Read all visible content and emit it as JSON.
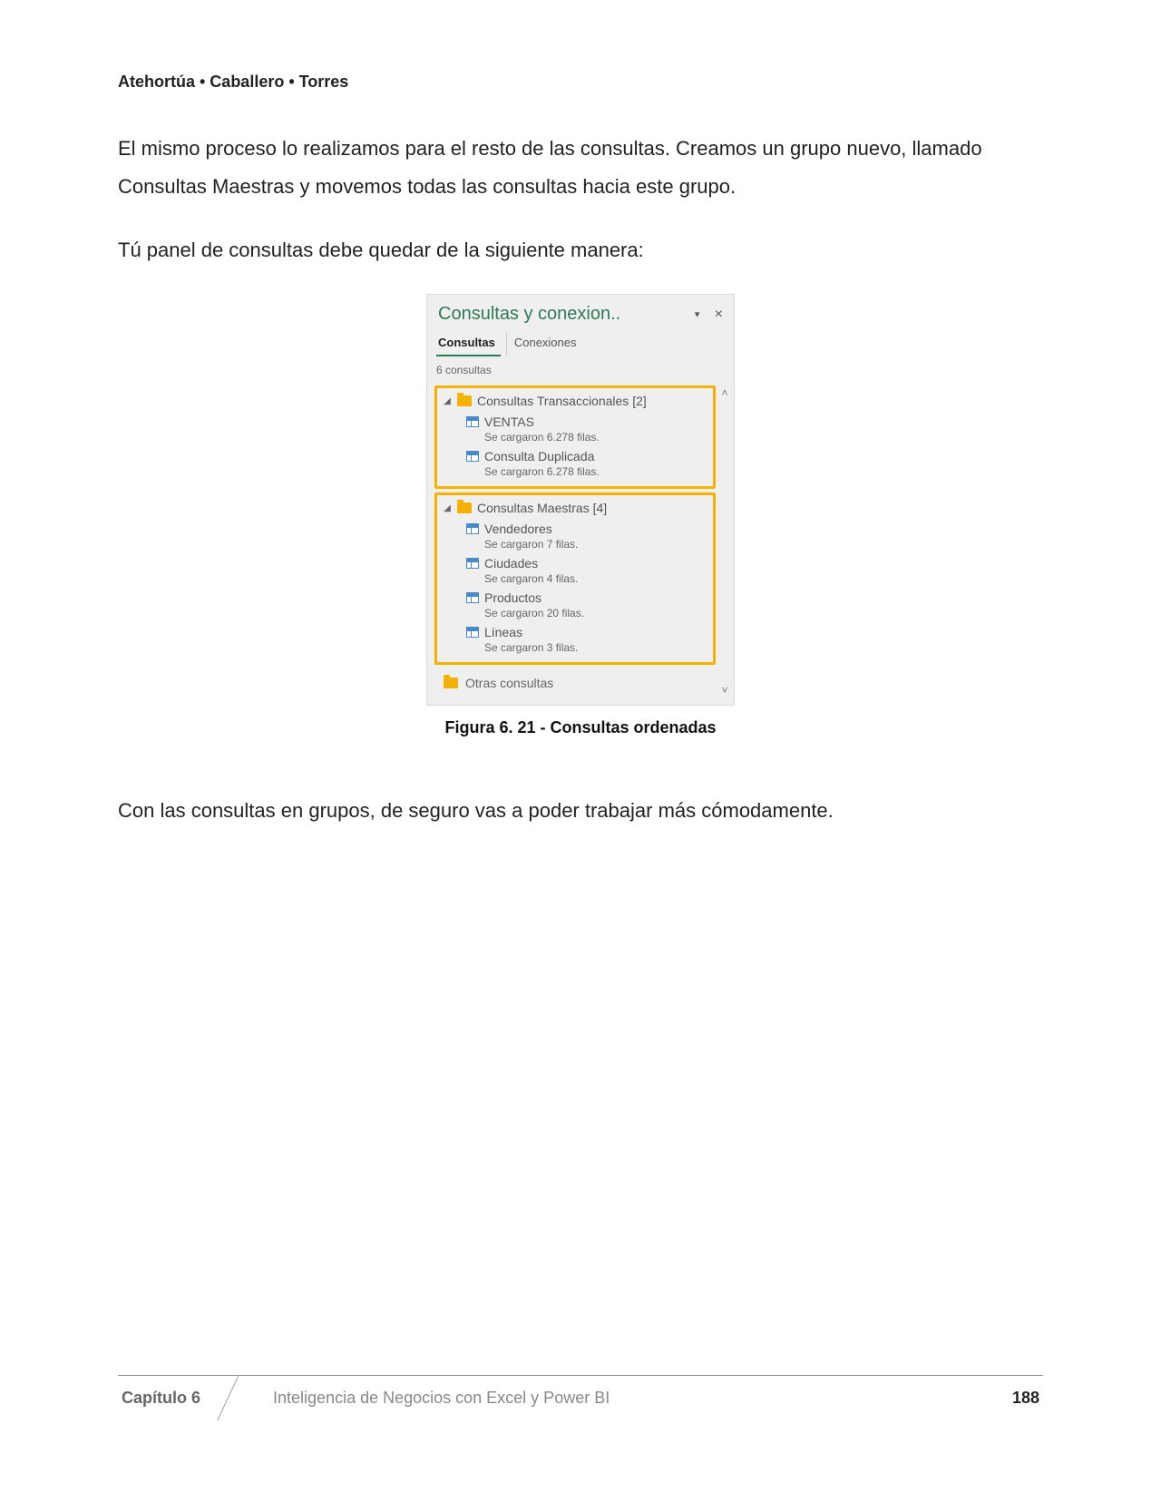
{
  "header": {
    "authors": "Atehortúa • Caballero • Torres"
  },
  "body": {
    "p1": "El mismo proceso lo realizamos para el resto de las consultas. Creamos un grupo nuevo, llamado Consultas Maestras y movemos todas las consultas hacia este grupo.",
    "p2": "Tú panel de consultas debe quedar de la siguiente manera:",
    "p3": "Con las consultas en grupos, de seguro vas a poder trabajar más cómodamente."
  },
  "pane": {
    "title": "Consultas y conexion..",
    "dropdown_glyph": "▾",
    "close_glyph": "×",
    "tabs": {
      "consultas": "Consultas",
      "conexiones": "Conexiones"
    },
    "count": "6 consultas",
    "scroll": {
      "up": "˄",
      "down": "˅"
    },
    "groups": [
      {
        "label": "Consultas Transaccionales [2]",
        "queries": [
          {
            "name": "VENTAS",
            "status": "Se cargaron 6.278 filas."
          },
          {
            "name": "Consulta Duplicada",
            "status": "Se cargaron 6.278 filas."
          }
        ]
      },
      {
        "label": "Consultas Maestras [4]",
        "queries": [
          {
            "name": "Vendedores",
            "status": "Se cargaron 7 filas."
          },
          {
            "name": "Ciudades",
            "status": "Se cargaron 4 filas."
          },
          {
            "name": "Productos",
            "status": "Se cargaron 20 filas."
          },
          {
            "name": "Líneas",
            "status": "Se cargaron 3 filas."
          }
        ]
      }
    ],
    "other": "Otras consultas"
  },
  "figure": {
    "caption": "Figura 6. 21 - Consultas ordenadas"
  },
  "footer": {
    "chapter": "Capítulo 6",
    "title": "Inteligencia de Negocios con Excel y Power BI",
    "page": "188"
  }
}
